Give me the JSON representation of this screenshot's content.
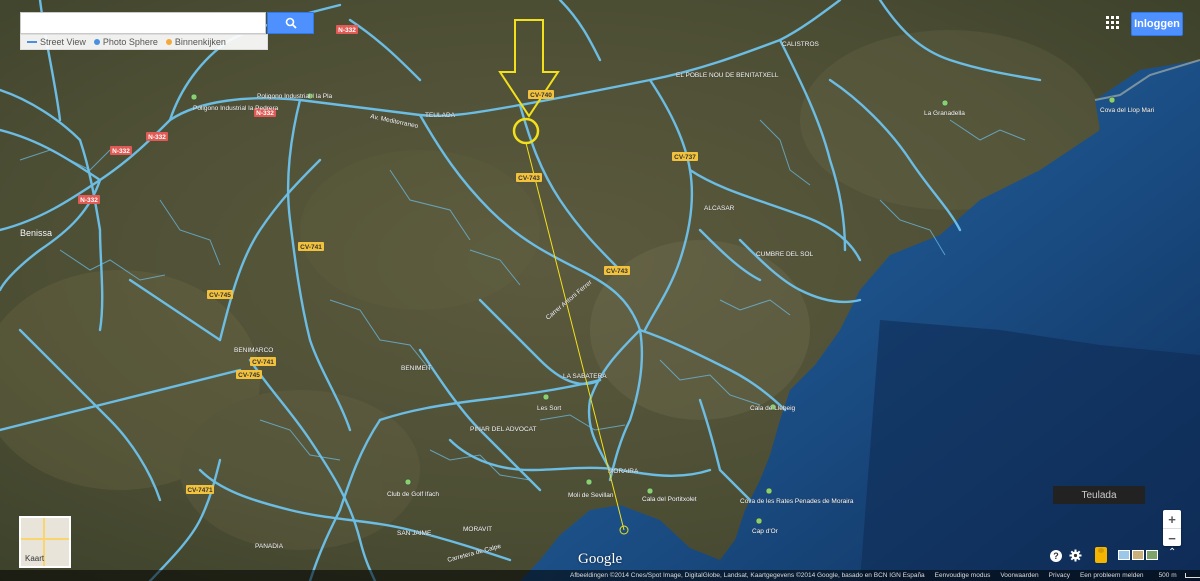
{
  "search": {
    "placeholder": "",
    "value": ""
  },
  "layers": [
    {
      "label": "Street View",
      "color": "#4a8fe0"
    },
    {
      "label": "Photo Sphere",
      "color": "#4a8fe0"
    },
    {
      "label": "Binnenkijken",
      "color": "#f4a93a"
    }
  ],
  "header": {
    "signin_label": "Inloggen"
  },
  "map": {
    "road_labels": [
      "N-332",
      "N-332",
      "N-332",
      "N-332",
      "N-332",
      "CV-740",
      "CV-743",
      "CV-743",
      "CV-741",
      "CV-745",
      "CV-741",
      "CV-745",
      "CV-737",
      "CV-7471"
    ],
    "place_labels": [
      "Benissa",
      "Poligono Industrial la Pedrera",
      "Poligono Industrial I la Pla",
      "TEULADA",
      "Av. Mediterraneo",
      "EL POBLE NOU DE BENITATXELL",
      "CALISTROS",
      "La Granadella",
      "Cova del Llop Mari",
      "ALCASAR",
      "CUMBRE DEL SOL",
      "BENIMARCO",
      "BENIMEIT",
      "LA SABATERA",
      "Les Sort",
      "Cala de Llebeig",
      "PINAR DEL ADVOCAT",
      "Club de Golf Ifach",
      "MORAIRA",
      "Moli de Sevillan",
      "Cala del Portitxolet",
      "Cova de les Rates Penades de Moraira",
      "Cap d'Or",
      "MORAVIT",
      "SAN JAIME",
      "PANADIA",
      "Carrer Antoni Ferrer",
      "Carretera de Calpe"
    ],
    "region_label": "Teulada",
    "minimap_label": "Kaart",
    "logo": "Google"
  },
  "controls": {
    "zoom_in": "+",
    "zoom_out": "−",
    "help": "?",
    "expand": "⌃"
  },
  "footer": {
    "attribution": "Afbeeldingen ©2014 Cnes/Spot Image, DigitalGlobe, Landsat, Kaartgegevens ©2014 Google, basado en BCN IGN España",
    "links": [
      "Eenvoudige modus",
      "Voorwaarden",
      "Privacy",
      "Een probleem melden"
    ],
    "scale": "500 m"
  }
}
